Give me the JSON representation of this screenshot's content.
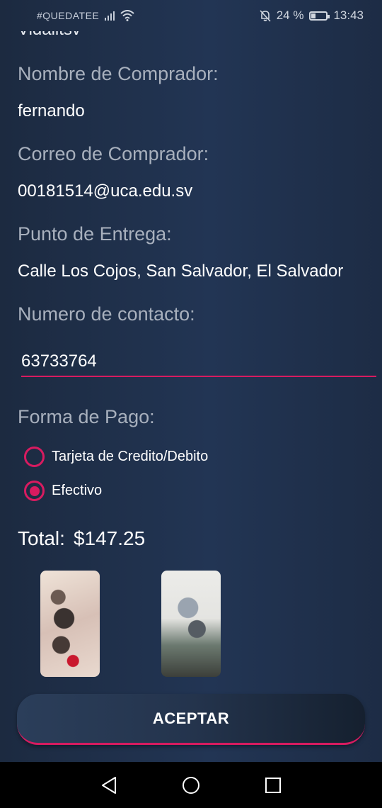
{
  "status_bar": {
    "carrier": "#QUEDATEE",
    "battery_percent": "24 %",
    "time": "13:43"
  },
  "form": {
    "cut_off_text": "Vidalitsv",
    "buyer_name_label": "Nombre de Comprador:",
    "buyer_name_value": "fernando",
    "buyer_email_label": "Correo de Comprador:",
    "buyer_email_value": "00181514@uca.edu.sv",
    "delivery_label": "Punto de Entrega:",
    "delivery_value": "Calle Los Cojos, San Salvador, El Salvador",
    "contact_label": "Numero de contacto:",
    "contact_value": "63733764",
    "payment_label": "Forma de Pago:",
    "payment_options": [
      {
        "label": "Tarjeta de Credito/Debito",
        "selected": false
      },
      {
        "label": "Efectivo",
        "selected": true
      }
    ],
    "total_label": "Total:",
    "total_value": "$147.25",
    "accept_label": "ACEPTAR"
  },
  "colors": {
    "accent": "#d81b60",
    "background": "#223554",
    "label_text": "#a8b0bd"
  },
  "nav": {
    "back_icon": "triangle-back-icon",
    "home_icon": "circle-home-icon",
    "recents_icon": "square-recents-icon"
  }
}
